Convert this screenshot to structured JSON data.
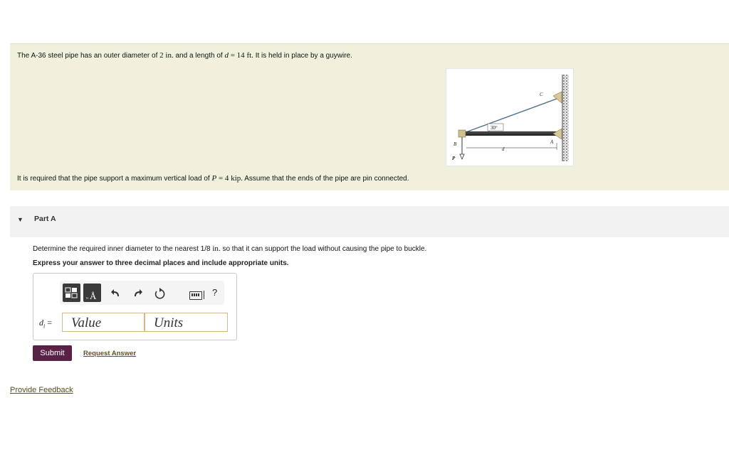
{
  "problem": {
    "line1": {
      "pre": "The A-36 steel pipe has an outer diameter of ",
      "diam_value": "2",
      "diam_unit": "in.",
      "mid": " and a length of ",
      "length_var": "d",
      "eq": " = ",
      "length_value": "14",
      "length_unit": "ft.",
      "post": " It is held in place by a guywire."
    },
    "line2": {
      "pre": "It is required that the pipe support a maximum vertical load of ",
      "load_var": "P",
      "eq": " = ",
      "load_value": "4",
      "load_unit": "kip.",
      "post": " Assume that the ends of the pipe are pin connected."
    },
    "figure": {
      "angle_label": "30°",
      "label_c": "C",
      "label_b": "B",
      "label_a": "A",
      "label_d": "d",
      "label_p": "P"
    }
  },
  "part": {
    "title": "Part A",
    "question": {
      "pre": "Determine the required inner diameter to the nearest ",
      "fraction": "1/8",
      "unit": "in.",
      "post": " so that it can support the load without causing the pipe to buckle."
    },
    "instruction": "Express your answer to three decimal places and include appropriate units.",
    "answer": {
      "var": "d",
      "sub": "i",
      "eq": " =",
      "value_placeholder": "Value",
      "units_placeholder": "Units"
    },
    "toolbar": {
      "help": "?"
    },
    "submit_label": "Submit",
    "request_label": "Request Answer"
  },
  "feedback_label": "Provide Feedback"
}
